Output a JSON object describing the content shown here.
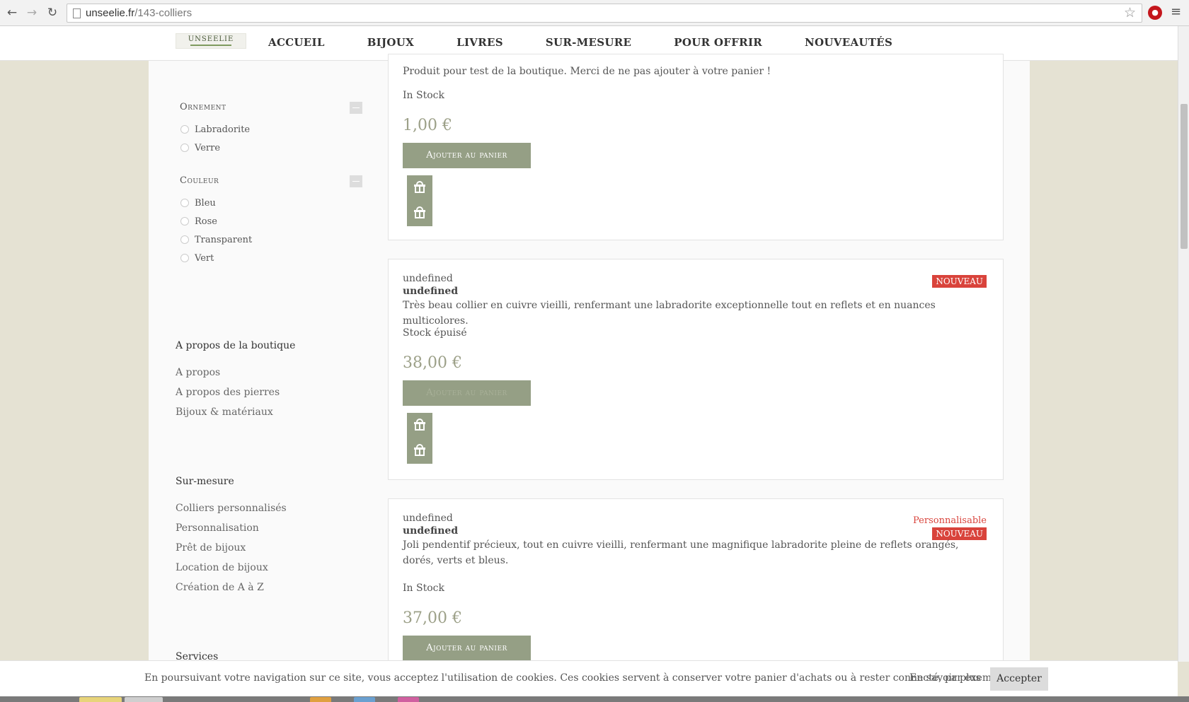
{
  "browser": {
    "url_host": "unseelie.fr",
    "url_path": "/143-colliers"
  },
  "header": {
    "logo_text": "UNSEELIE",
    "nav": [
      "ACCUEIL",
      "BIJOUX",
      "LIVRES",
      "SUR-MESURE",
      "POUR OFFRIR",
      "NOUVEAUTÉS"
    ]
  },
  "sidebar": {
    "filters": [
      {
        "title": "Ornement",
        "options": [
          "Labradorite",
          "Verre"
        ]
      },
      {
        "title": "Couleur",
        "options": [
          "Bleu",
          "Rose",
          "Transparent",
          "Vert"
        ]
      }
    ],
    "sections": [
      {
        "title": "A propos de la boutique",
        "links": [
          "A propos",
          "A propos des pierres",
          "Bijoux & matériaux"
        ]
      },
      {
        "title": "Sur-mesure",
        "links": [
          "Colliers personnalisés",
          "Personnalisation",
          "Prêt de bijoux",
          "Location de bijoux",
          "Création de A à Z"
        ]
      },
      {
        "title": "Services",
        "links": []
      }
    ]
  },
  "products": [
    {
      "description": "Produit pour test de la boutique. Merci de ne pas ajouter à votre panier !",
      "stock": "In Stock",
      "price": "1,00 €",
      "button": "Ajouter au panier"
    },
    {
      "category": "undefined",
      "name": "undefined",
      "badge_new": "NOUVEAU",
      "description": "Très beau collier en cuivre vieilli, renfermant une labradorite exceptionnelle tout en reflets et en nuances multicolores.",
      "stock": "Stock épuisé",
      "price": "38,00 €",
      "button": "Ajouter au panier"
    },
    {
      "category": "undefined",
      "name": "undefined",
      "badge_perso": "Personnalisable",
      "badge_new": "NOUVEAU",
      "description": "Joli pendentif précieux, tout en cuivre vieilli, renfermant une magnifique labradorite pleine de reflets orangés, dorés, verts et bleus.",
      "stock": "In Stock",
      "price": "37,00 €",
      "button": "Ajouter au panier"
    }
  ],
  "cookie": {
    "text": "En poursuivant votre navigation sur ce site, vous acceptez l'utilisation de cookies. Ces cookies servent à conserver votre panier d'achats ou à rester connecté, par exemple.",
    "more": "En savoir plus",
    "accept": "Accepter"
  },
  "colors": {
    "page_bg": "#e5e2d3",
    "button": "#959f85",
    "price": "#9ca088",
    "badge": "#d9433b"
  },
  "icons": [
    "back-arrow-icon",
    "forward-arrow-icon",
    "reload-icon",
    "page-icon",
    "star-icon",
    "extension-icon",
    "menu-icon",
    "gift-icon",
    "collapse-icon"
  ]
}
